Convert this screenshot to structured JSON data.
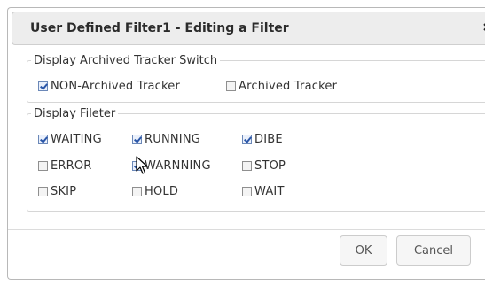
{
  "dialog": {
    "title": "User Defined Filter1 - Editing a Filter",
    "close_glyph": "✖"
  },
  "archived_group": {
    "legend": "Display Archived Tracker Switch",
    "options": [
      {
        "label": "NON-Archived Tracker",
        "checked": true
      },
      {
        "label": "Archived Tracker",
        "checked": false
      }
    ]
  },
  "filter_group": {
    "legend": "Display Fileter",
    "options": [
      {
        "label": "WAITING",
        "checked": true
      },
      {
        "label": "RUNNING",
        "checked": true
      },
      {
        "label": "DIBE",
        "checked": true
      },
      {
        "label": "ERROR",
        "checked": false
      },
      {
        "label": "WARNNING",
        "checked": true
      },
      {
        "label": "STOP",
        "checked": false
      },
      {
        "label": "SKIP",
        "checked": false
      },
      {
        "label": "HOLD",
        "checked": false
      },
      {
        "label": "WAIT",
        "checked": false
      }
    ]
  },
  "footer": {
    "ok_label": "OK",
    "cancel_label": "Cancel"
  },
  "cursor_icon": "arrow-pointer-icon"
}
